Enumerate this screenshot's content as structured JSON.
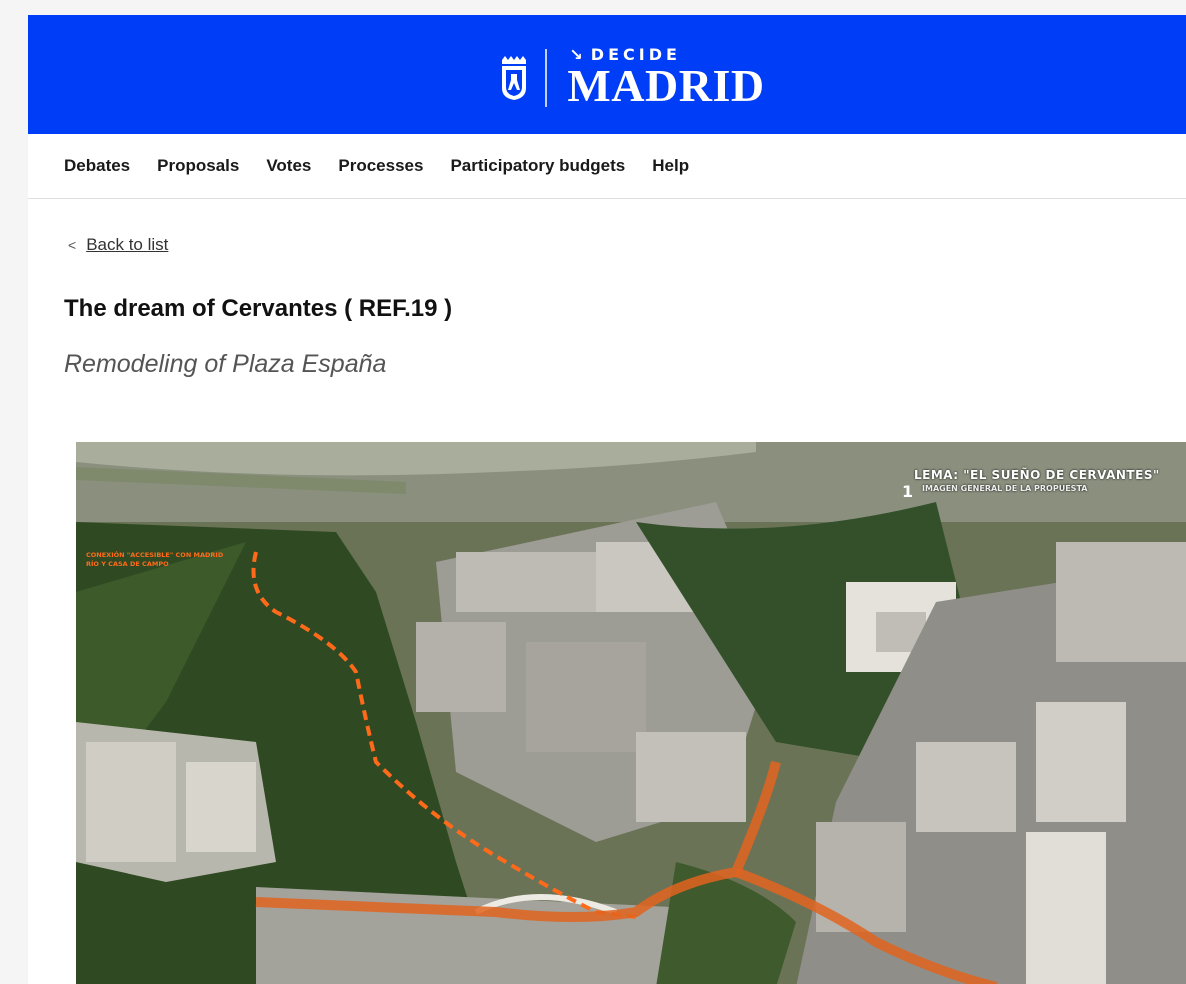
{
  "brand": {
    "top": "DECIDE",
    "main": "MADRID",
    "color": "#003df6"
  },
  "nav": {
    "items": [
      {
        "label": "Debates"
      },
      {
        "label": "Proposals"
      },
      {
        "label": "Votes"
      },
      {
        "label": "Processes"
      },
      {
        "label": "Participatory budgets"
      },
      {
        "label": "Help"
      }
    ]
  },
  "back": {
    "icon": "chevron-left-icon",
    "label": "Back to list"
  },
  "proposal": {
    "title": "The dream of Cervantes ( REF.19 )",
    "subtitle": "Remodeling of Plaza España"
  },
  "image": {
    "lema": "LEMA: \"EL SUEÑO DE CERVANTES\"",
    "lema_number": "1",
    "lema_subtitle": "IMAGEN GENERAL DE LA PROPUESTA",
    "conexion": "CONEXIÓN \"ACCESIBLE\" CON MADRID RÍO Y CASA DE CAMPO"
  }
}
